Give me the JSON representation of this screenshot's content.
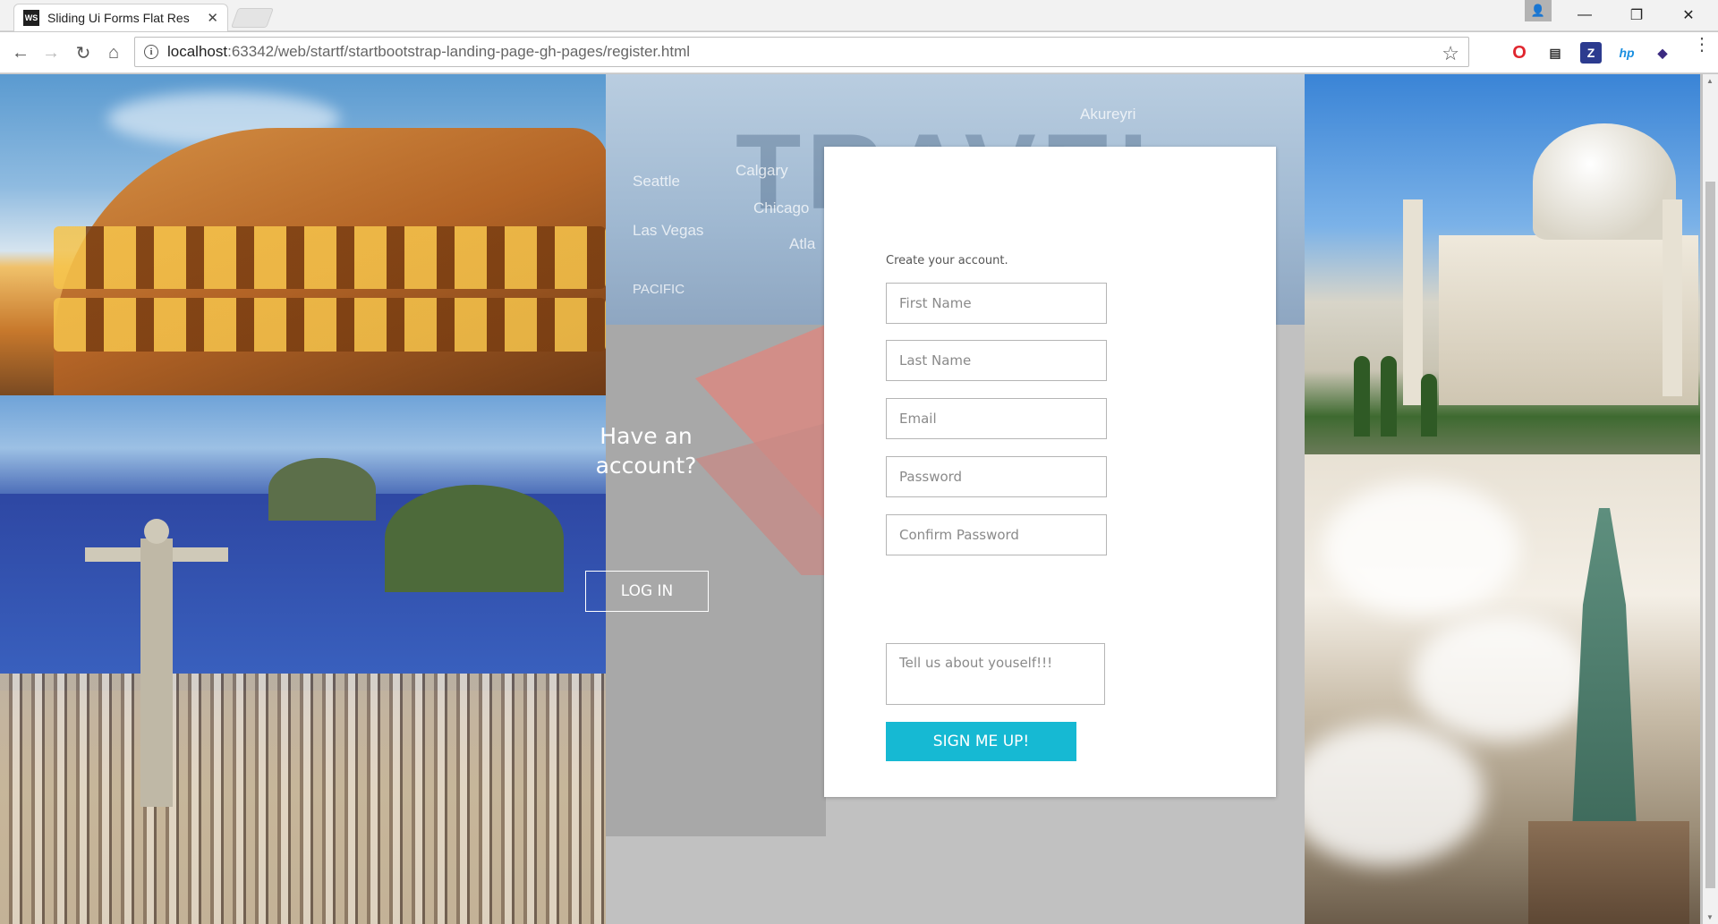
{
  "browser": {
    "tab_title": "Sliding Ui Forms Flat Res",
    "tab_favicon": "WS",
    "url_host": "localhost",
    "url_rest": ":63342/web/startf/startbootstrap-landing-page-gh-pages/register.html"
  },
  "left_panel": {
    "heading": "Have an account?",
    "login_button": "LOG IN"
  },
  "map_labels": [
    "Seattle",
    "Calgary",
    "Las Vegas",
    "Chicago",
    "Atla",
    "PACIFIC",
    "Akureyri",
    "TRAVEL"
  ],
  "form": {
    "subtitle": "Create your account.",
    "first_name_placeholder": "First Name",
    "last_name_placeholder": "Last Name",
    "email_placeholder": "Email",
    "password_placeholder": "Password",
    "confirm_password_placeholder": "Confirm Password",
    "about_placeholder": "Tell us about youself!!!",
    "submit_label": "SIGN ME UP!"
  },
  "colors": {
    "accent": "#16b9d3",
    "overlay": "#a8a8a8"
  }
}
